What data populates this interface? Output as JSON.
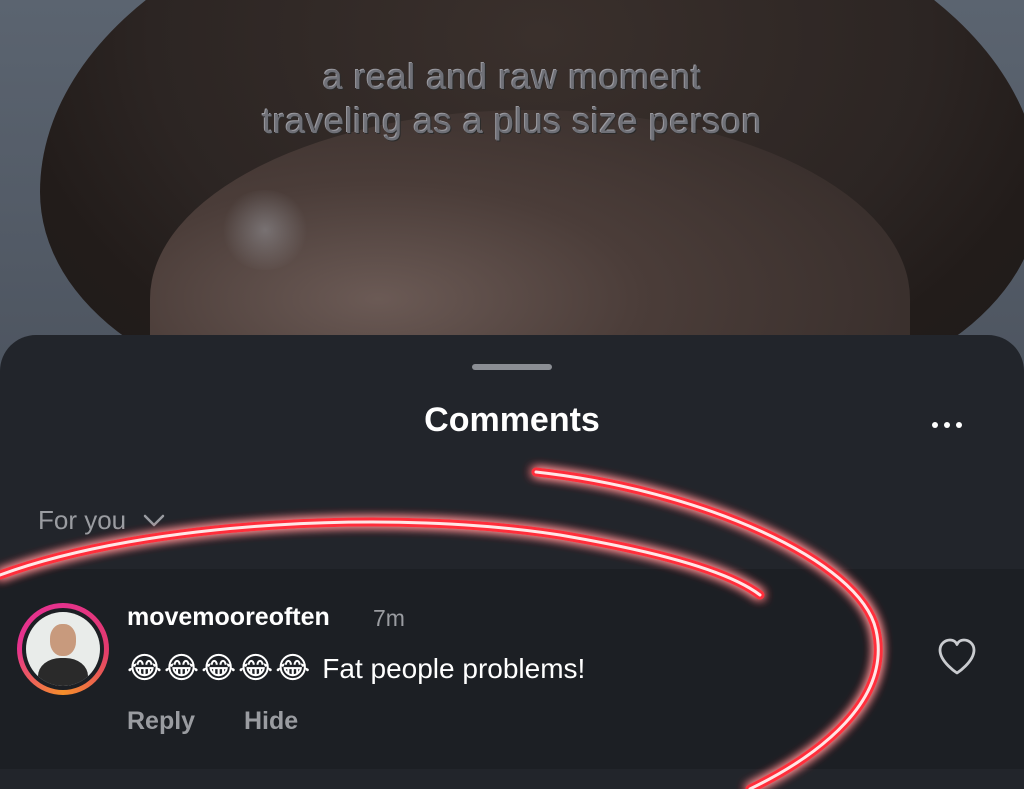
{
  "video": {
    "caption_line1": "a real and raw moment",
    "caption_line2": "traveling as a plus size person"
  },
  "sheet": {
    "title": "Comments",
    "more_icon": "ellipsis-icon",
    "filter_label": "For you",
    "filter_icon": "chevron-down-icon"
  },
  "comment": {
    "username": "movemooreoften",
    "time": "7m",
    "emojis": "😂😂😂😂😂",
    "text": "Fat people problems!",
    "reply_label": "Reply",
    "hide_label": "Hide",
    "like_icon": "heart-outline-icon"
  },
  "colors": {
    "sheet_bg": "#22252b",
    "comment_bg": "#1c1f24",
    "muted_text": "#9a9ca1",
    "annotation": "#ff2d3a",
    "avatar_ring_start": "#e5328c",
    "avatar_ring_end": "#f58f2a"
  }
}
